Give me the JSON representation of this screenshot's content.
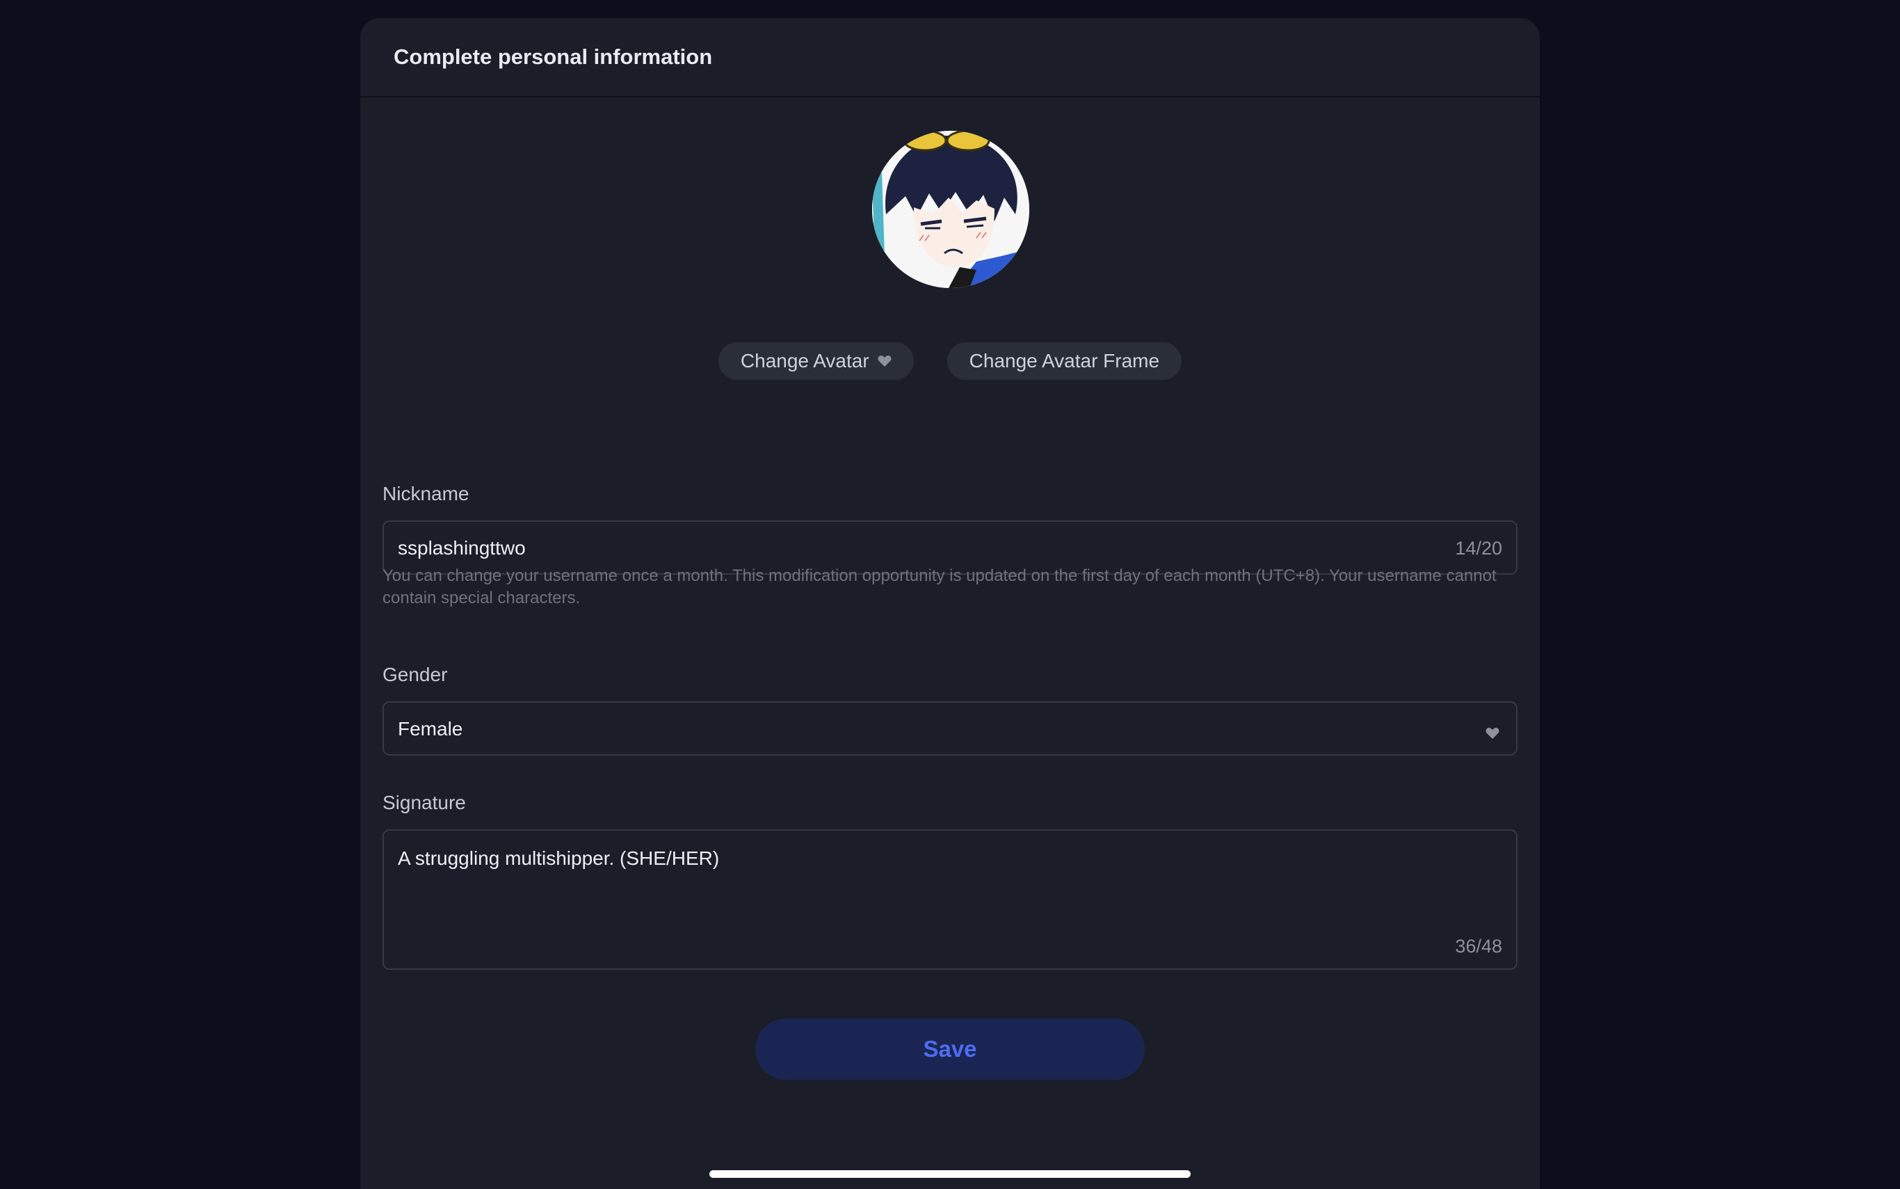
{
  "header": {
    "title": "Complete personal information"
  },
  "avatar": {
    "icon": "avatar-character-image",
    "change_avatar_label": "Change Avatar",
    "change_avatar_icon": "heart-icon",
    "change_frame_label": "Change Avatar Frame"
  },
  "nickname": {
    "label": "Nickname",
    "value": "ssplashingttwo",
    "counter": "14/20",
    "hint": "You can change your username once a month. This modification opportunity is updated on the first day of each month (UTC+8). Your username cannot contain special characters."
  },
  "gender": {
    "label": "Gender",
    "value": "Female",
    "icon": "heart-dropdown-icon"
  },
  "signature": {
    "label": "Signature",
    "value": "A struggling multishipper. (SHE/HER)",
    "counter": "36/48"
  },
  "actions": {
    "save_label": "Save"
  },
  "colors": {
    "background": "#0c0f1b",
    "panel": "#1b1e28",
    "save_bg": "#1b2553",
    "save_text": "#4e6cf2"
  }
}
